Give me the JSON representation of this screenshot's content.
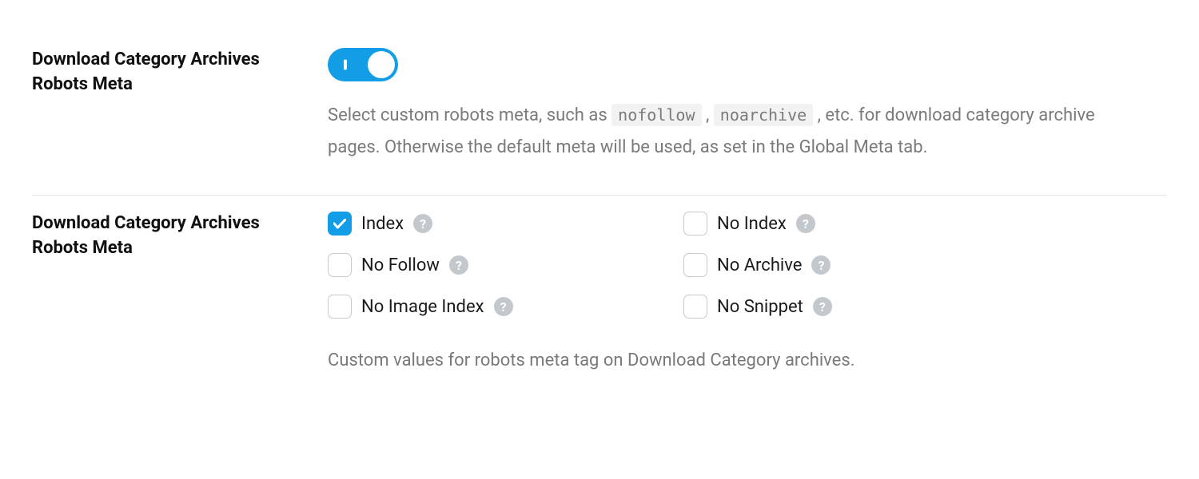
{
  "section1": {
    "label": "Download Category Archives Robots Meta",
    "toggle_on": true,
    "desc_parts": {
      "p1": "Select custom robots meta, such as",
      "code1": "nofollow",
      "p2": ",",
      "code2": "noarchive",
      "p3": ", etc. for download category archive pages. Otherwise the default meta will be used, as set in the Global Meta tab."
    }
  },
  "section2": {
    "label": "Download Category Archives Robots Meta",
    "options": [
      {
        "label": "Index",
        "checked": true
      },
      {
        "label": "No Index",
        "checked": false
      },
      {
        "label": "No Follow",
        "checked": false
      },
      {
        "label": "No Archive",
        "checked": false
      },
      {
        "label": "No Image Index",
        "checked": false
      },
      {
        "label": "No Snippet",
        "checked": false
      }
    ],
    "help_text": "Custom values for robots meta tag on Download Category archives."
  },
  "help_glyph": "?"
}
